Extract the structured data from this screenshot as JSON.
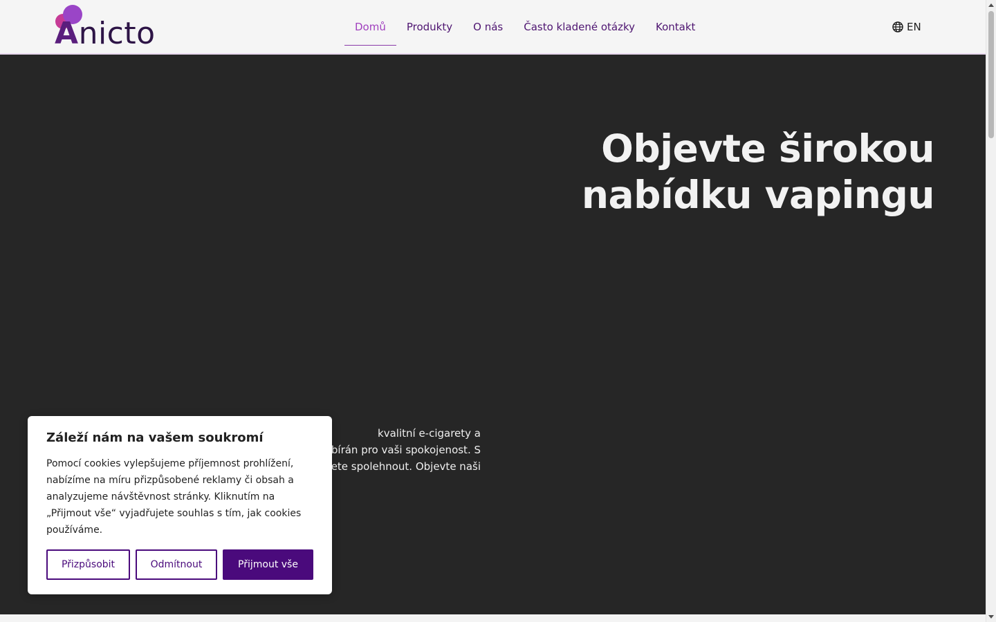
{
  "header": {
    "logo_text": "Anicto",
    "nav": [
      {
        "label": "Domů",
        "active": true
      },
      {
        "label": "Produkty",
        "active": false
      },
      {
        "label": "O nás",
        "active": false
      },
      {
        "label": "Často kladené otázky",
        "active": false
      },
      {
        "label": "Kontakt",
        "active": false
      }
    ],
    "language": {
      "icon": "globe-icon",
      "label": "EN"
    }
  },
  "hero": {
    "title": "Objevte širokou nabídku vapingu",
    "text": "kvalitní e-cigarety a\nybírán pro vaši spokojenost. S\nžete spolehnout. Objevte naši"
  },
  "cookie_banner": {
    "title": "Záleží nám na vašem soukromí",
    "text": "Pomocí cookies vylepšujeme příjemnost prohlížení, nabízíme na míru přizpůsobené reklamy či obsah a analyzujeme návštěvnost stránky. Kliknutím na „Přijmout vše“ vyjadřujete souhlas s tím, jak cookies používáme.",
    "buttons": {
      "customize": "Přizpůsobit",
      "reject": "Odmítnout",
      "accept": "Přijmout vše"
    }
  },
  "colors": {
    "brand": "#4a0a7c",
    "nav_active": "#a03fbe",
    "hero_background": "#262626"
  }
}
